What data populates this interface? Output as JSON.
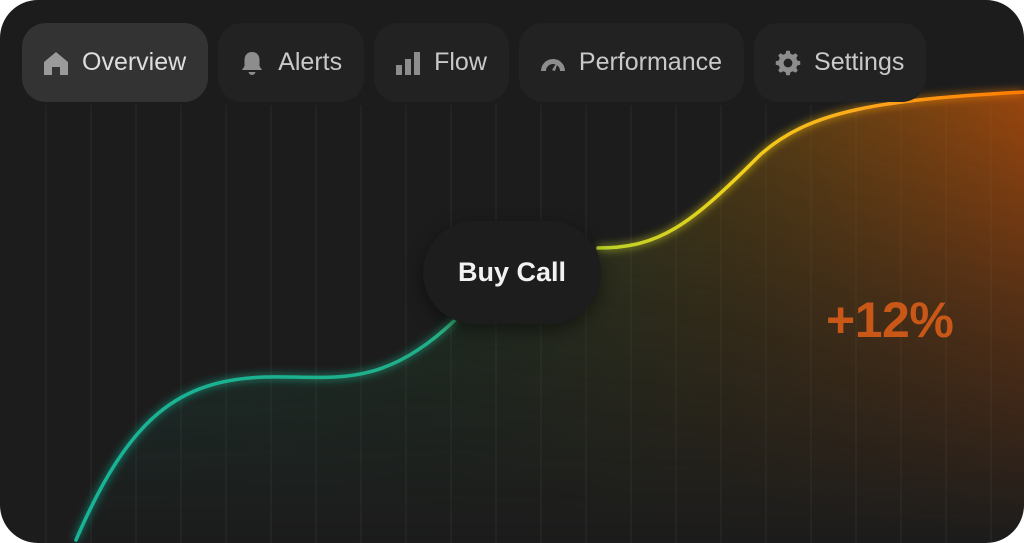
{
  "tabs": [
    {
      "label": "Overview",
      "icon": "home-icon",
      "active": true
    },
    {
      "label": "Alerts",
      "icon": "bell-icon",
      "active": false
    },
    {
      "label": "Flow",
      "icon": "bar-chart-icon",
      "active": false
    },
    {
      "label": "Performance",
      "icon": "gauge-icon",
      "active": false
    },
    {
      "label": "Settings",
      "icon": "gear-icon",
      "active": false
    }
  ],
  "action": {
    "label": "Buy Call"
  },
  "change": {
    "label": "+12%"
  },
  "colors": {
    "background": "#1c1c1c",
    "line_start": "#16b59a",
    "line_mid": "#e8d21c",
    "line_end": "#ff7a00",
    "change_text": "#c85718"
  }
}
